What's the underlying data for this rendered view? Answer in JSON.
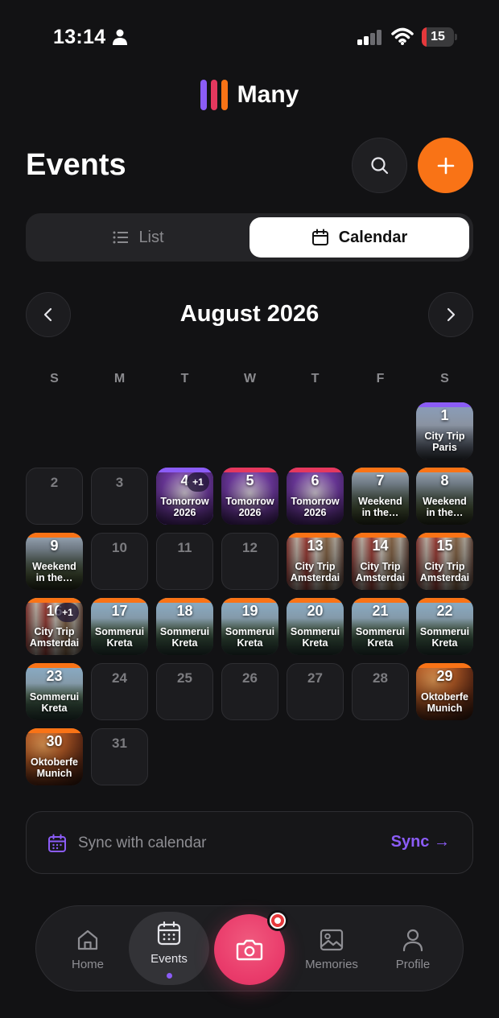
{
  "status_bar": {
    "time": "13:14",
    "battery": "15",
    "battery_level": 0.15,
    "icons": [
      "person-icon",
      "cellular-signal-icon",
      "wifi-icon",
      "battery-icon"
    ]
  },
  "app": {
    "name": "Many",
    "logo_colors": [
      "#8b5cf6",
      "#e5385e",
      "#f97316"
    ]
  },
  "header": {
    "title": "Events",
    "search_icon": "search-icon",
    "add_icon": "plus-icon"
  },
  "view_toggle": {
    "options": [
      {
        "label": "List",
        "icon": "list-icon",
        "selected": false
      },
      {
        "label": "Calendar",
        "icon": "calendar-icon",
        "selected": true
      }
    ]
  },
  "calendar": {
    "month_label": "August 2026",
    "prev_icon": "chevron-left-icon",
    "next_icon": "chevron-right-icon",
    "weekdays": [
      "S",
      "M",
      "T",
      "W",
      "T",
      "F",
      "S"
    ],
    "first_weekday": 6,
    "days_in_month": 31,
    "selected_day": 4,
    "days": [
      {
        "day": "1",
        "label": "City Trip\nParis",
        "theme": "paris",
        "color": "#8b5cf6"
      },
      {
        "day": "4",
        "label": "Tomorrow\n2026",
        "theme": "party",
        "color": "#8b5cf6",
        "more": "+1"
      },
      {
        "day": "5",
        "label": "Tomorrow\n2026",
        "theme": "party",
        "color": "#e5385e"
      },
      {
        "day": "6",
        "label": "Tomorrow\n2026",
        "theme": "party",
        "color": "#e5385e"
      },
      {
        "day": "7",
        "label": "Weekend\nin the…",
        "theme": "mount",
        "color": "#f97316"
      },
      {
        "day": "8",
        "label": "Weekend\nin the…",
        "theme": "mount",
        "color": "#f97316"
      },
      {
        "day": "9",
        "label": "Weekend\nin the…",
        "theme": "mount",
        "color": "#f97316"
      },
      {
        "day": "13",
        "label": "City Trip\nAmsterdai",
        "theme": "ams",
        "color": "#f97316"
      },
      {
        "day": "14",
        "label": "City Trip\nAmsterdai",
        "theme": "ams",
        "color": "#f97316"
      },
      {
        "day": "15",
        "label": "City Trip\nAmsterdai",
        "theme": "ams",
        "color": "#f97316"
      },
      {
        "day": "16",
        "label": "City Trip\nAmsterdai",
        "theme": "ams",
        "color": "#f97316",
        "more": "+1"
      },
      {
        "day": "17",
        "label": "Sommerui\nKreta",
        "theme": "kreta",
        "color": "#f97316"
      },
      {
        "day": "18",
        "label": "Sommerui\nKreta",
        "theme": "kreta",
        "color": "#f97316"
      },
      {
        "day": "19",
        "label": "Sommerui\nKreta",
        "theme": "kreta",
        "color": "#f97316"
      },
      {
        "day": "20",
        "label": "Sommerui\nKreta",
        "theme": "kreta",
        "color": "#f97316"
      },
      {
        "day": "21",
        "label": "Sommerui\nKreta",
        "theme": "kreta",
        "color": "#f97316"
      },
      {
        "day": "22",
        "label": "Sommerui\nKreta",
        "theme": "kreta",
        "color": "#f97316"
      },
      {
        "day": "23",
        "label": "Sommerui\nKreta",
        "theme": "kreta",
        "color": "#f97316"
      },
      {
        "day": "29",
        "label": "Oktoberfe\nMunich",
        "theme": "munich",
        "color": "#f97316"
      },
      {
        "day": "30",
        "label": "Oktoberfe\nMunich",
        "theme": "munich",
        "color": "#f97316"
      }
    ]
  },
  "sync": {
    "text": "Sync with calendar",
    "button": "Sync",
    "arrow": "→",
    "icon": "calendar-sync-icon"
  },
  "bottom_nav": {
    "items": [
      {
        "label": "Home",
        "icon": "home-icon"
      },
      {
        "label": "Events",
        "icon": "calendar-icon",
        "active": true
      },
      {
        "label": "Memories",
        "icon": "image-icon"
      },
      {
        "label": "Profile",
        "icon": "person-icon"
      }
    ],
    "camera_icon": "camera-icon",
    "accent": "#8b5cf6"
  }
}
